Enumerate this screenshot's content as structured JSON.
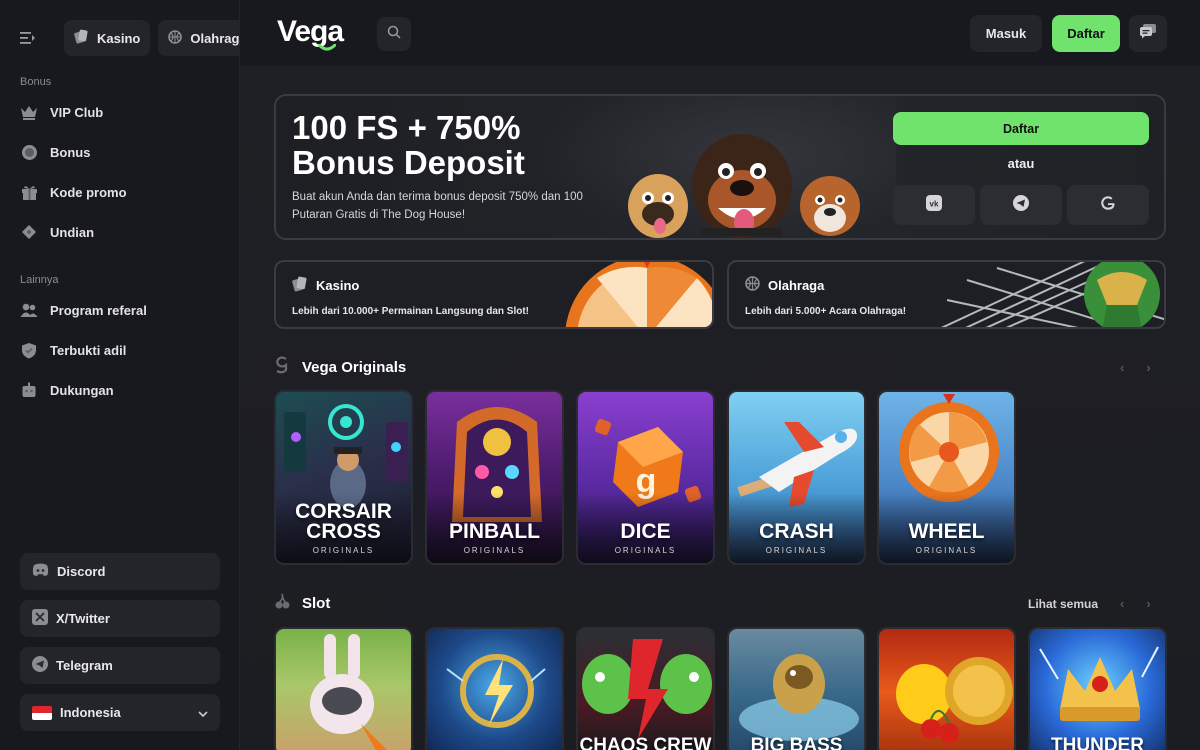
{
  "sidebar": {
    "tabs": [
      {
        "label": "Kasino",
        "icon": "cards-icon"
      },
      {
        "label": "Olahraga",
        "icon": "ball-icon"
      }
    ],
    "section_bonus": "Bonus",
    "bonus_items": [
      {
        "label": "VIP Club",
        "icon": "crown-icon"
      },
      {
        "label": "Bonus",
        "icon": "coin-icon"
      },
      {
        "label": "Kode promo",
        "icon": "gift-icon"
      },
      {
        "label": "Undian",
        "icon": "ticket-icon"
      }
    ],
    "section_other": "Lainnya",
    "other_items": [
      {
        "label": "Program referal",
        "icon": "users-icon"
      },
      {
        "label": "Terbukti adil",
        "icon": "shield-icon"
      },
      {
        "label": "Dukungan",
        "icon": "robot-icon"
      }
    ],
    "social": [
      {
        "label": "Discord",
        "icon": "discord-icon"
      },
      {
        "label": "X/Twitter",
        "icon": "x-icon"
      },
      {
        "label": "Telegram",
        "icon": "telegram-icon"
      }
    ],
    "language": "Indonesia"
  },
  "header": {
    "logo": "Vega",
    "login": "Masuk",
    "register": "Daftar"
  },
  "hero": {
    "title_line1": "100 FS + 750%",
    "title_line2": "Bonus Deposit",
    "description": "Buat akun Anda dan terima bonus deposit 750% dan 100 Putaran Gratis di The Dog House!",
    "register": "Daftar",
    "or": "atau"
  },
  "categories": [
    {
      "title": "Kasino",
      "desc": "Lebih dari 10.000+ Permainan Langsung dan Slot!"
    },
    {
      "title": "Olahraga",
      "desc": "Lebih dari 5.000+ Acara Olahraga!"
    }
  ],
  "originals": {
    "title": "Vega Originals",
    "games": [
      {
        "title1": "CORSAIR",
        "title2": "CROSS",
        "sub": "ORIGINALS"
      },
      {
        "title1": "",
        "title2": "PINBALL",
        "sub": "ORIGINALS"
      },
      {
        "title1": "",
        "title2": "DICE",
        "sub": "ORIGINALS"
      },
      {
        "title1": "",
        "title2": "CRASH",
        "sub": "ORIGINALS"
      },
      {
        "title1": "",
        "title2": "WHEEL",
        "sub": "ORIGINALS"
      }
    ]
  },
  "slot": {
    "title": "Slot",
    "see_all": "Lihat semua",
    "games": [
      {
        "title": ""
      },
      {
        "title": ""
      },
      {
        "title": "CHAOS CREW"
      },
      {
        "title": "BIG BASS"
      },
      {
        "title": ""
      },
      {
        "title": "THUNDER"
      }
    ]
  },
  "colors": {
    "accent": "#6fe36b",
    "background": "#1b1c21",
    "panel": "#24252b"
  }
}
